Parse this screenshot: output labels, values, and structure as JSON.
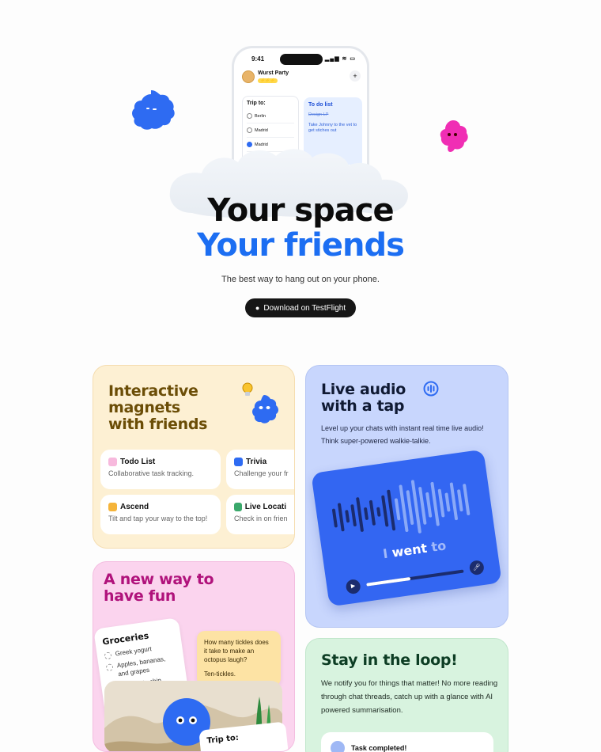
{
  "hero": {
    "phone": {
      "time": "9:41",
      "status": "▂▄▆ ≋ ▭",
      "party_name": "Wurst Party",
      "party_badge": "⚡⚡⚡",
      "add_symbol": "+",
      "trip_title": "Trip to:",
      "trip_items": [
        "Berlin",
        "Madrid",
        "Madrid"
      ],
      "todo_title": "To do list",
      "todo_items": [
        "Design LP",
        "Take Johnny to the vet to get stiches out"
      ]
    },
    "title_line1": "Your space",
    "title_line2": "Your friends",
    "tagline": "The best way to hang out on your phone.",
    "cta_label": "Download on TestFlight",
    "cta_icon": "apple-icon"
  },
  "magnets": {
    "title_l1": "Interactive",
    "title_l2": "magnets",
    "title_l3": "with friends",
    "tiles": [
      {
        "name": "Todo List",
        "desc": "Collaborative task tracking.",
        "color": "#f7b9dd"
      },
      {
        "name": "Trivia",
        "desc": "Challenge your fr",
        "color": "#2e6bf2"
      },
      {
        "name": "Ascend",
        "desc": "Tilt and tap your way to the top!",
        "color": "#f5b43a"
      },
      {
        "name": "Live Locati",
        "desc": "Check in on frien",
        "color": "#3aa86b"
      }
    ]
  },
  "audio": {
    "title_l1": "Live audio",
    "title_l2": "with a tap",
    "desc": "Level up your chats with instant real time live audio! Think super-powered walkie-talkie.",
    "word_a": "I",
    "word_b": "went",
    "word_c": "to",
    "play_symbol": "▶",
    "mute_symbol": "🎤︎",
    "progress": 0.45,
    "accent": "#3366f2"
  },
  "fun": {
    "title_l1": "A new way to",
    "title_l2": "have fun",
    "groceries_title": "Groceries",
    "groceries": [
      "Greek yogurt",
      "Apples, bananas, and grapes",
      "Chocolate chip"
    ],
    "quiz_question": "How many tickles does it take to make an octopus laugh?",
    "quiz_answer": "Ten-tickles.",
    "trip_title": "Trip to:"
  },
  "loop": {
    "title": "Stay in the loop!",
    "desc": "We notify you for things that matter! No more reading through chat threads, catch up with a glance with AI powered summarisation.",
    "notif": "Task completed!"
  }
}
